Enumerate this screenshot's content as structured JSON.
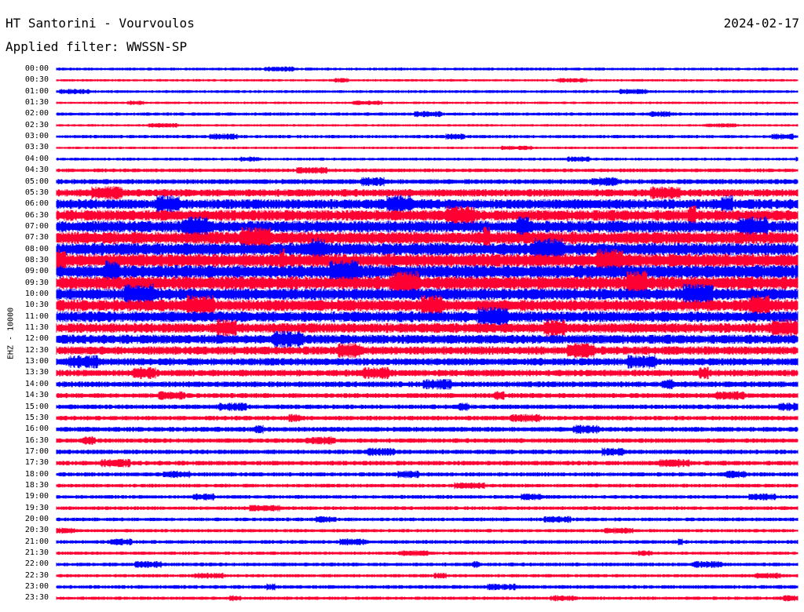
{
  "header": {
    "station": "HT Santorini - Vourvoulos",
    "date": "2024-02-17",
    "filter": "Applied filter: WWSSN-SP"
  },
  "chart_data": {
    "type": "line",
    "ylabel": "EHZ - 10000",
    "colors": [
      "#0000ff",
      "#ff0033"
    ],
    "rows": [
      {
        "time": "00:00",
        "amplitude": 0.35,
        "color": "#0000ff"
      },
      {
        "time": "00:30",
        "amplitude": 0.3,
        "color": "#ff0033"
      },
      {
        "time": "01:00",
        "amplitude": 0.35,
        "color": "#0000ff"
      },
      {
        "time": "01:30",
        "amplitude": 0.3,
        "color": "#ff0033"
      },
      {
        "time": "02:00",
        "amplitude": 0.4,
        "color": "#0000ff"
      },
      {
        "time": "02:30",
        "amplitude": 0.3,
        "color": "#ff0033"
      },
      {
        "time": "03:00",
        "amplitude": 0.4,
        "color": "#0000ff"
      },
      {
        "time": "03:30",
        "amplitude": 0.3,
        "color": "#ff0033"
      },
      {
        "time": "04:00",
        "amplitude": 0.35,
        "color": "#0000ff"
      },
      {
        "time": "04:30",
        "amplitude": 0.45,
        "color": "#ff0033"
      },
      {
        "time": "05:00",
        "amplitude": 0.6,
        "color": "#0000ff"
      },
      {
        "time": "05:30",
        "amplitude": 0.9,
        "color": "#ff0033"
      },
      {
        "time": "06:00",
        "amplitude": 1.2,
        "color": "#0000ff"
      },
      {
        "time": "06:30",
        "amplitude": 1.3,
        "color": "#ff0033"
      },
      {
        "time": "07:00",
        "amplitude": 1.4,
        "color": "#0000ff"
      },
      {
        "time": "07:30",
        "amplitude": 1.5,
        "color": "#ff0033"
      },
      {
        "time": "08:00",
        "amplitude": 1.5,
        "color": "#0000ff"
      },
      {
        "time": "08:30",
        "amplitude": 1.6,
        "color": "#ff0033"
      },
      {
        "time": "09:00",
        "amplitude": 1.6,
        "color": "#0000ff"
      },
      {
        "time": "09:30",
        "amplitude": 1.6,
        "color": "#ff0033"
      },
      {
        "time": "10:00",
        "amplitude": 1.4,
        "color": "#0000ff"
      },
      {
        "time": "10:30",
        "amplitude": 1.4,
        "color": "#ff0033"
      },
      {
        "time": "11:00",
        "amplitude": 1.3,
        "color": "#0000ff"
      },
      {
        "time": "11:30",
        "amplitude": 1.2,
        "color": "#ff0033"
      },
      {
        "time": "12:00",
        "amplitude": 1.1,
        "color": "#0000ff"
      },
      {
        "time": "12:30",
        "amplitude": 1.0,
        "color": "#ff0033"
      },
      {
        "time": "13:00",
        "amplitude": 0.9,
        "color": "#0000ff"
      },
      {
        "time": "13:30",
        "amplitude": 0.8,
        "color": "#ff0033"
      },
      {
        "time": "14:00",
        "amplitude": 0.7,
        "color": "#0000ff"
      },
      {
        "time": "14:30",
        "amplitude": 0.6,
        "color": "#ff0033"
      },
      {
        "time": "15:00",
        "amplitude": 0.55,
        "color": "#0000ff"
      },
      {
        "time": "15:30",
        "amplitude": 0.55,
        "color": "#ff0033"
      },
      {
        "time": "16:00",
        "amplitude": 0.6,
        "color": "#0000ff"
      },
      {
        "time": "16:30",
        "amplitude": 0.55,
        "color": "#ff0033"
      },
      {
        "time": "17:00",
        "amplitude": 0.55,
        "color": "#0000ff"
      },
      {
        "time": "17:30",
        "amplitude": 0.55,
        "color": "#ff0033"
      },
      {
        "time": "18:00",
        "amplitude": 0.5,
        "color": "#0000ff"
      },
      {
        "time": "18:30",
        "amplitude": 0.45,
        "color": "#ff0033"
      },
      {
        "time": "19:00",
        "amplitude": 0.45,
        "color": "#0000ff"
      },
      {
        "time": "19:30",
        "amplitude": 0.45,
        "color": "#ff0033"
      },
      {
        "time": "20:00",
        "amplitude": 0.45,
        "color": "#0000ff"
      },
      {
        "time": "20:30",
        "amplitude": 0.4,
        "color": "#ff0033"
      },
      {
        "time": "21:00",
        "amplitude": 0.45,
        "color": "#0000ff"
      },
      {
        "time": "21:30",
        "amplitude": 0.4,
        "color": "#ff0033"
      },
      {
        "time": "22:00",
        "amplitude": 0.45,
        "color": "#0000ff"
      },
      {
        "time": "22:30",
        "amplitude": 0.4,
        "color": "#ff0033"
      },
      {
        "time": "23:00",
        "amplitude": 0.45,
        "color": "#0000ff"
      },
      {
        "time": "23:30",
        "amplitude": 0.4,
        "color": "#ff0033"
      }
    ]
  }
}
